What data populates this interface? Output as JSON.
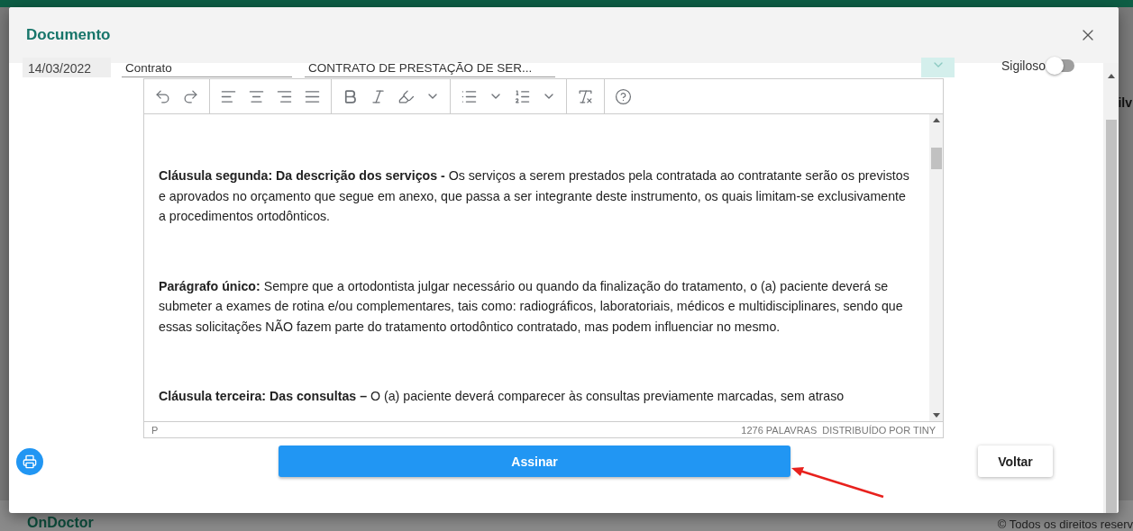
{
  "background": {
    "logo": "OnDoctor",
    "footer": "© Todos os direitos reserv",
    "side_text": "ilv"
  },
  "dialog": {
    "title": "Documento",
    "fields": {
      "date": "14/03/2022",
      "type": "Contrato",
      "title": "CONTRATO DE PRESTAÇÃO DE SER..."
    },
    "sigiloso": {
      "label": "Sigiloso",
      "on": false
    },
    "editor": {
      "paragraphs": [
        "**Cláusula segunda: Da descrição dos serviços -** Os serviços a serem prestados pela contratada ao contratante serão os previstos e aprovados no orçamento que segue em anexo, que passa a ser integrante deste instrumento, os quais limitam-se exclusivamente a procedimentos ortodônticos.",
        "**Parágrafo único:** Sempre que a ortodontista julgar necessário ou quando da finalização do tratamento, o (a) paciente deverá se submeter a exames de rotina e/ou complementares, tais como: radiográficos, laboratoriais, médicos e multidisciplinares, sendo que essas solicitações NÃO fazem parte do tratamento ortodôntico contratado, mas podem influenciar no mesmo.",
        "**Cláusula terceira: Das consultas –** O (a) paciente deverá comparecer às consultas previamente marcadas, sem atraso"
      ],
      "status_path": "P",
      "word_count": "1276 PALAVRAS",
      "branding": "DISTRIBUÍDO POR TINY"
    },
    "buttons": {
      "sign": "Assinar",
      "back": "Voltar"
    }
  }
}
